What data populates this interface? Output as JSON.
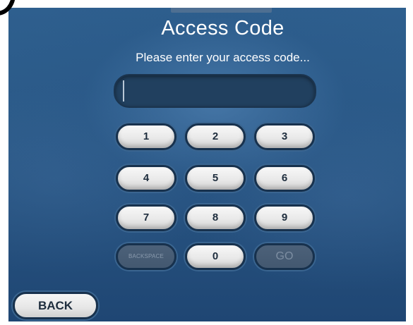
{
  "header": {
    "title": "Access Code",
    "subtitle": "Please enter your access code..."
  },
  "code_field": {
    "value": "",
    "placeholder": ""
  },
  "keypad": {
    "keys": [
      "1",
      "2",
      "3",
      "4",
      "5",
      "6",
      "7",
      "8",
      "9",
      "BACKSPACE",
      "0",
      "GO"
    ]
  },
  "navigation": {
    "back_label": "BACK"
  },
  "colors": {
    "background": "#2a5886",
    "key_face": "#e9e9e9",
    "key_border": "#17314d",
    "key_disabled": "#4c6179",
    "text_light": "#ffffff",
    "text_dark": "#1e2d3d"
  }
}
